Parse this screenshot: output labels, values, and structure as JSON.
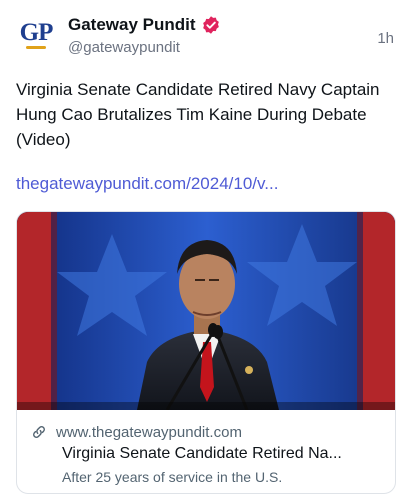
{
  "author": {
    "display_name": "Gateway Pundit",
    "handle": "@gatewaypundit",
    "avatar_text": "GP"
  },
  "post": {
    "timestamp": "1h",
    "text": "Virginia Senate Candidate Retired Navy Captain Hung Cao Brutalizes Tim Kaine During Debate (Video)",
    "link_text": "thegatewaypundit.com/2024/10/v..."
  },
  "link_card": {
    "domain": "www.thegatewaypundit.com",
    "title": "Virginia Senate Candidate Retired Na...",
    "description": "After 25 years of service in the U.S."
  },
  "colors": {
    "link": "#4f5bd5",
    "verified_badge": "#e0245e",
    "muted_text": "#6b7280"
  },
  "icons": {
    "verified": "verified-badge-icon",
    "link": "link-icon"
  }
}
